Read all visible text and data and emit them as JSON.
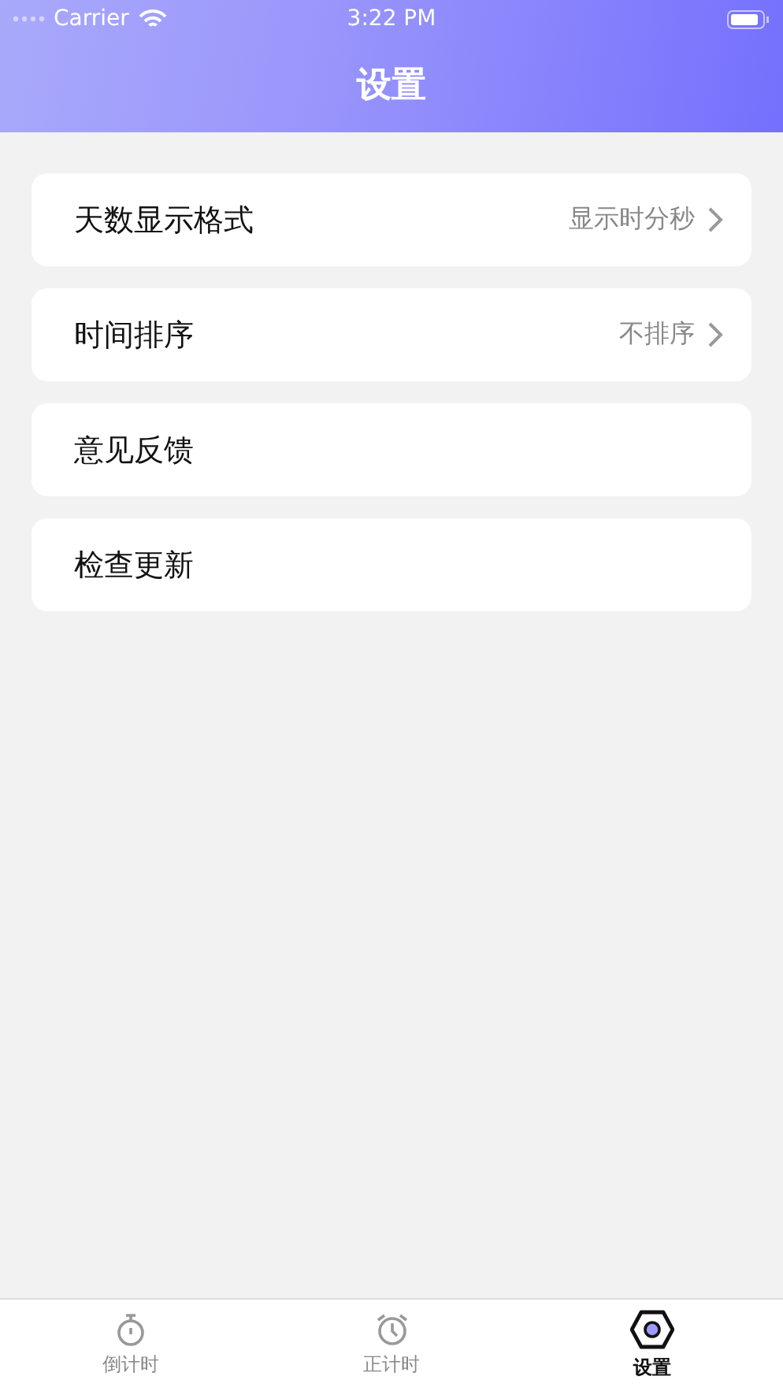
{
  "status_bar": {
    "carrier": "Carrier",
    "time": "3:22 PM"
  },
  "nav": {
    "title": "设置"
  },
  "settings": [
    {
      "label": "天数显示格式",
      "value": "显示时分秒",
      "chevron": true
    },
    {
      "label": "时间排序",
      "value": "不排序",
      "chevron": true
    },
    {
      "label": "意见反馈",
      "chevron": false
    },
    {
      "label": "检查更新",
      "chevron": false
    }
  ],
  "tabs": [
    {
      "label": "倒计时",
      "kind": "stopwatch",
      "selected": false
    },
    {
      "label": "正计时",
      "kind": "alarm",
      "selected": false
    },
    {
      "label": "设置",
      "kind": "settings",
      "selected": true
    }
  ]
}
